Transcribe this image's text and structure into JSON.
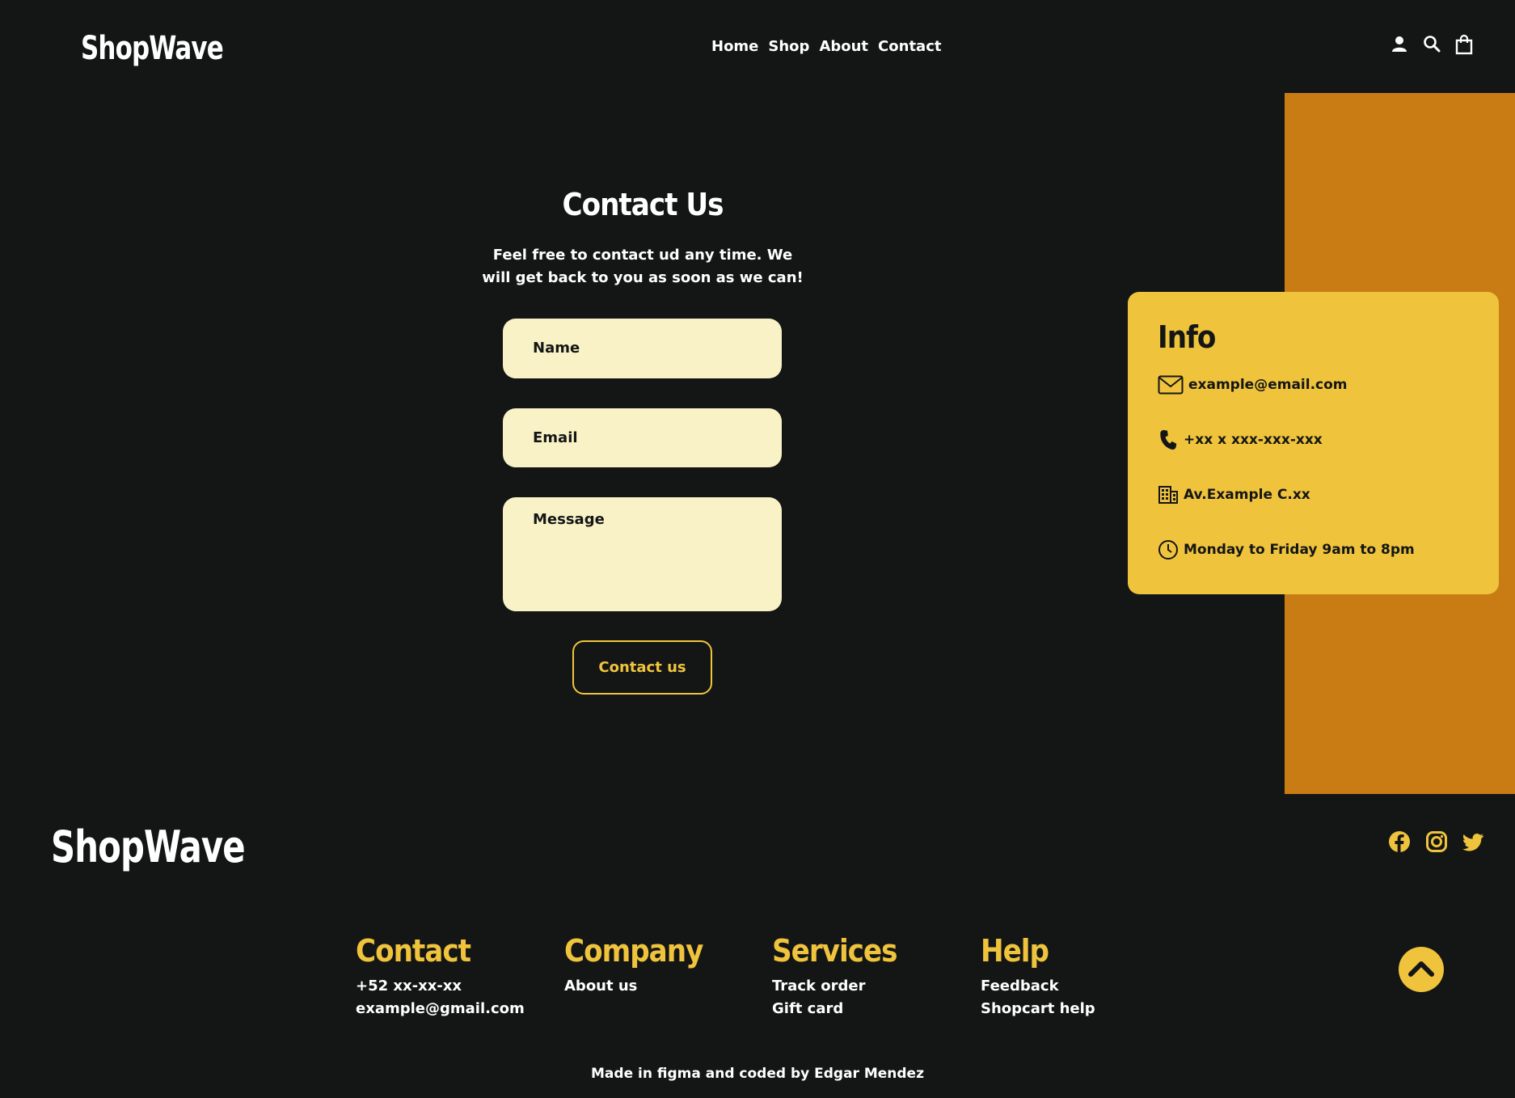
{
  "brand": "ShopWave",
  "nav": [
    "Home",
    "Shop",
    "About",
    "Contact"
  ],
  "header_icons": [
    "user-icon",
    "search-icon",
    "shopping-bag-icon"
  ],
  "contact": {
    "title": "Contact Us",
    "subtitle": "Feel free to contact ud any time. We will get back to you as soon as we can!",
    "name_placeholder": "Name",
    "email_placeholder": "Email",
    "message_placeholder": "Message",
    "button": "Contact us"
  },
  "info": {
    "title": "Info",
    "email": "example@email.com",
    "phone": "+xx x xxx-xxx-xxx",
    "address": "Av.Example C.xx",
    "hours": "Monday to Friday 9am to 8pm"
  },
  "footer": {
    "brand": "ShopWave",
    "social_icons": [
      "facebook-icon",
      "instagram-icon",
      "twitter-icon"
    ],
    "columns": [
      {
        "title": "Contact",
        "links": [
          "+52 xx-xx-xx",
          "example@gmail.com"
        ]
      },
      {
        "title": "Company",
        "links": [
          "About us"
        ]
      },
      {
        "title": "Services",
        "links": [
          "Track order",
          "Gift card"
        ]
      },
      {
        "title": "Help",
        "links": [
          "Feedback",
          "Shopcart help"
        ]
      }
    ],
    "credit": "Made in figma and coded by Edgar Mendez"
  },
  "colors": {
    "background": "#141616",
    "accent": "#efc33c",
    "orange": "#ca7c14",
    "input_bg": "#f9f2c7"
  }
}
